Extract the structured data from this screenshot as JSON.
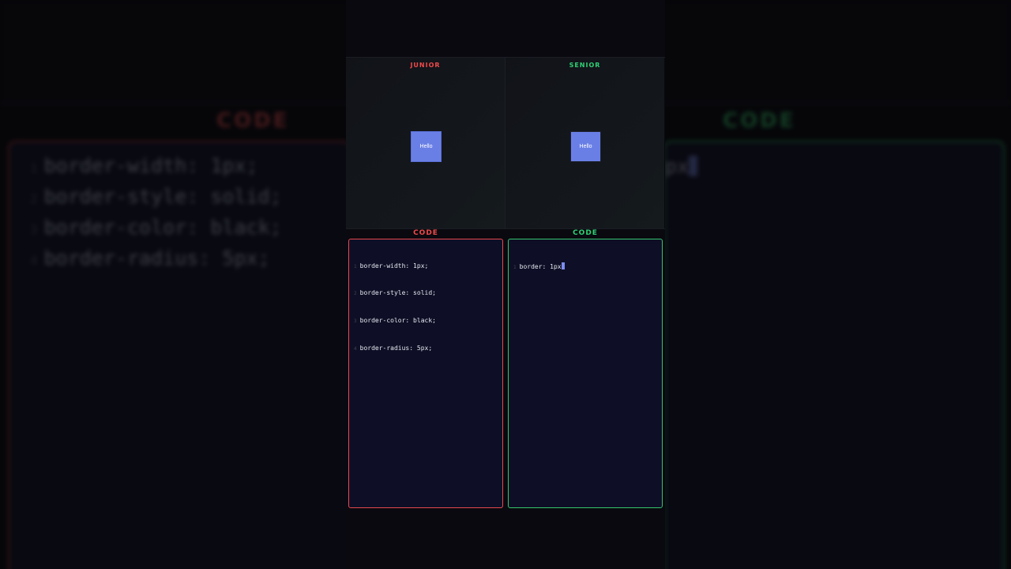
{
  "preview": {
    "junior_label": "JUNIOR",
    "senior_label": "SENIOR",
    "junior_box_text": "Hello",
    "senior_box_text": "Hello"
  },
  "code": {
    "junior_heading": "CODE",
    "senior_heading": "CODE",
    "junior_lines": [
      {
        "num": "1",
        "text": "border-width: 1px;"
      },
      {
        "num": "2",
        "text": "border-style: solid;"
      },
      {
        "num": "3",
        "text": "border-color: black;"
      },
      {
        "num": "4",
        "text": "border-radius: 5px;"
      }
    ],
    "senior_lines": [
      {
        "num": "1",
        "text": "border: 1px"
      }
    ]
  },
  "background": {
    "left_heading": "CODE",
    "right_heading": "CODE",
    "left_lines": [
      {
        "num": "1",
        "text": "border-width: 1px;"
      },
      {
        "num": "2",
        "text": "border-style: solid;"
      },
      {
        "num": "3",
        "text": "border-color: black;"
      },
      {
        "num": "4",
        "text": "border-radius: 5px;"
      }
    ],
    "right_fragment": "px"
  },
  "colors": {
    "junior_accent": "#ef4a4a",
    "senior_accent": "#2fd074",
    "demo_box": "#6a7fe6",
    "editor_bg": "#0e0f26"
  }
}
